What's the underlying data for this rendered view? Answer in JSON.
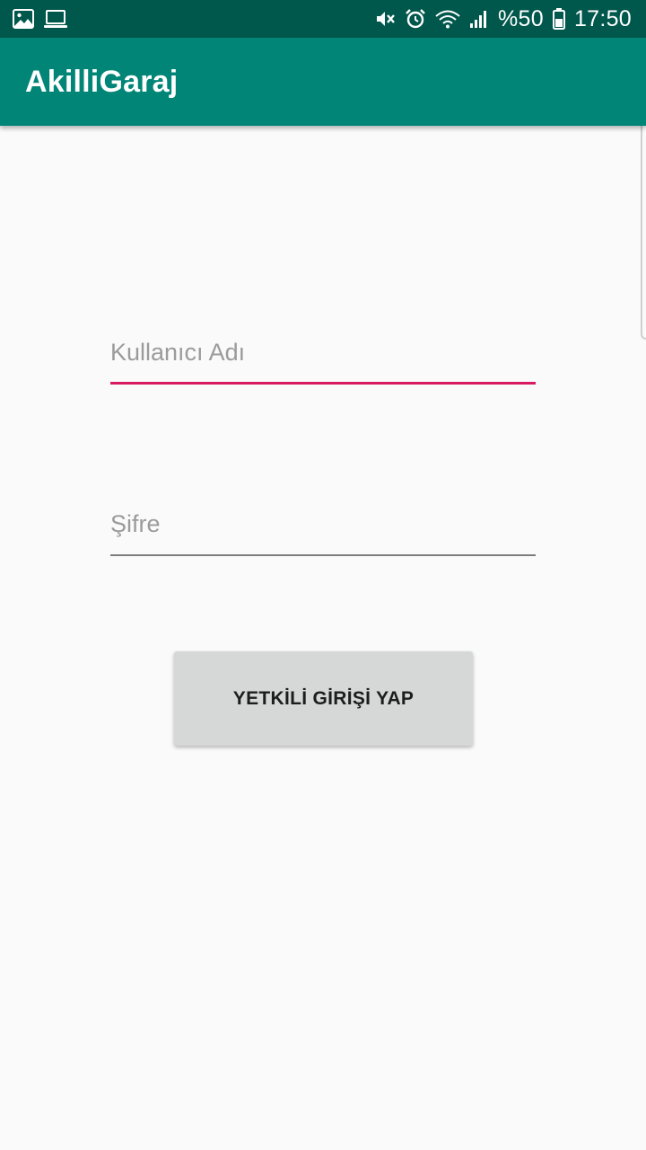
{
  "status_bar": {
    "left_icons": [
      "gallery-icon",
      "laptop-icon"
    ],
    "right_icons": [
      "mute-icon",
      "alarm-icon",
      "wifi-icon",
      "signal-icon"
    ],
    "battery_text": "%50",
    "battery_icon": "battery-icon",
    "time": "17:50",
    "background": "#00574b"
  },
  "app_bar": {
    "title": "AkilliGaraj",
    "background": "#008577"
  },
  "login_form": {
    "username": {
      "value": "",
      "placeholder": "Kullanıcı Adı",
      "accent_color": "#d81b60"
    },
    "password": {
      "value": "",
      "placeholder": "Şifre"
    },
    "submit_label": "YETKİLİ GİRİŞİ YAP"
  }
}
